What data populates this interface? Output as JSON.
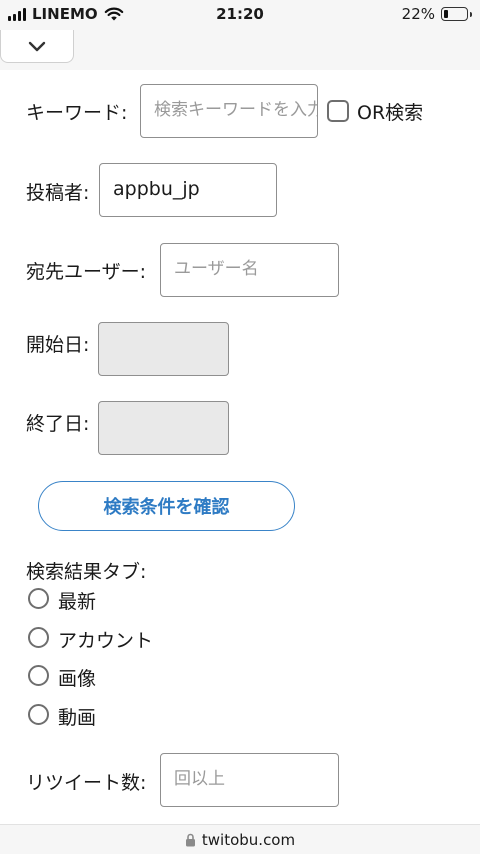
{
  "status_bar": {
    "carrier": "LINEMO",
    "time": "21:20",
    "battery": "22%",
    "battery_level": 0.22
  },
  "form": {
    "keyword": {
      "label": "キーワード:",
      "placeholder": "検索キーワードを入力",
      "or_label": "OR検索",
      "or_checked": false
    },
    "author": {
      "label": "投稿者:",
      "value": "appbu_jp"
    },
    "recipient": {
      "label": "宛先ユーザー:",
      "placeholder": "ユーザー名"
    },
    "start_date": {
      "label": "開始日:",
      "value": ""
    },
    "end_date": {
      "label": "終了日:",
      "value": ""
    },
    "confirm_button": "検索条件を確認",
    "result_tab": {
      "label": "検索結果タブ:",
      "options": [
        "最新",
        "アカウント",
        "画像",
        "動画"
      ],
      "selected": null
    },
    "retweets": {
      "label": "リツイート数:",
      "placeholder": "回以上"
    }
  },
  "url_bar": {
    "domain": "twitobu.com"
  },
  "colors": {
    "accent": "#2e7bc4",
    "chrome": "#f6f6f6"
  },
  "icons": [
    "signal-icon",
    "wifi-icon",
    "battery-icon",
    "chevron-down-icon",
    "lock-icon"
  ]
}
